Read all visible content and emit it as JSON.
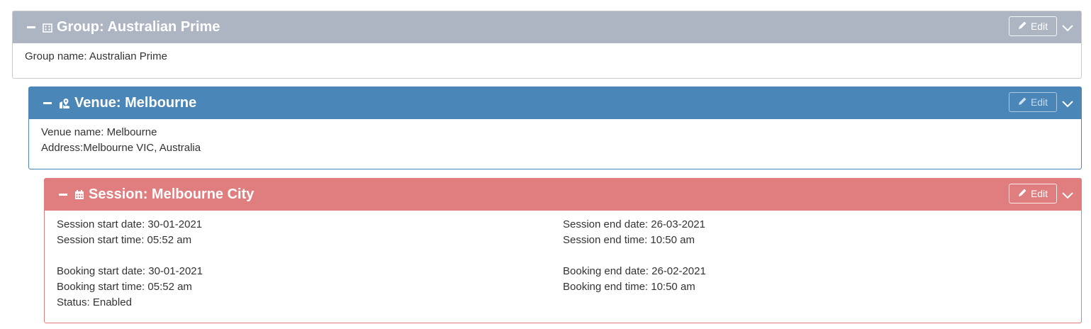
{
  "group": {
    "title": "Group: Australian Prime",
    "edit_label": "Edit",
    "icon": "building-icon",
    "color": "#adb5c3",
    "fields": {
      "name_line": "Group name: Australian Prime"
    }
  },
  "venue": {
    "title": "Venue: Melbourne",
    "edit_label": "Edit",
    "icon": "map-marker-icon",
    "color": "#4a86b8",
    "fields": {
      "name_line": "Venue name: Melbourne",
      "address_line": "Address:Melbourne VIC, Australia"
    }
  },
  "session": {
    "title": "Session: Melbourne City",
    "edit_label": "Edit",
    "icon": "calendar-icon",
    "color": "#e07d7e",
    "fields": {
      "session_start_date": "Session start date: 30-01-2021",
      "session_start_time": "Session start time: 05:52 am",
      "session_end_date": "Session end date: 26-03-2021",
      "session_end_time": "Session end time: 10:50 am",
      "booking_start_date": "Booking start date: 30-01-2021",
      "booking_start_time": "Booking start time: 05:52 am",
      "booking_end_date": "Booking end date: 26-02-2021",
      "booking_end_time": "Booking end time: 10:50 am",
      "status": "Status: Enabled"
    }
  }
}
